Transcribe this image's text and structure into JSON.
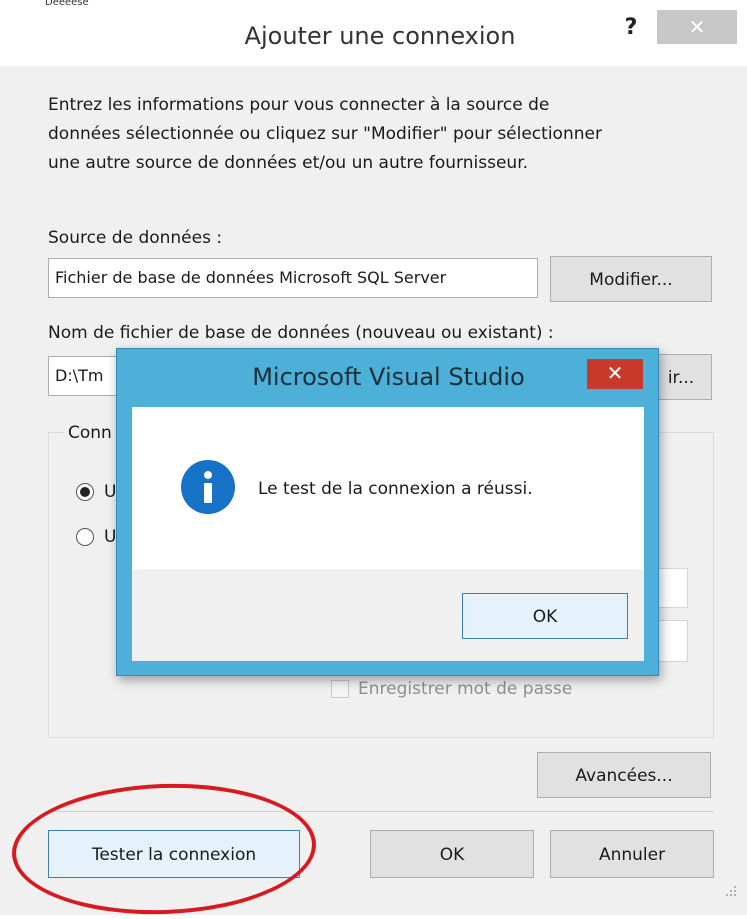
{
  "dialog": {
    "top_strip": "Deeeese",
    "title": "Ajouter une connexion",
    "help": "?",
    "close": "✕",
    "intro_lines": [
      "Entrez les informations pour vous connecter à la source de",
      "données sélectionnée ou cliquez sur \"Modifier\" pour sélectionner",
      "une autre source de données et/ou un autre fournisseur."
    ],
    "source_label": "Source de données :",
    "source_value": "Fichier de base de données Microsoft SQL Server",
    "modify_button": "Modifier...",
    "filename_label": "Nom de fichier de base de données (nouveau ou existant) :",
    "filename_value": "D:\\Tm",
    "browse_button": "ir...",
    "conn_group_label": "Conn",
    "radio1_label": "U",
    "radio2_label": "U",
    "save_password_label": "Enregistrer mot de passe",
    "advanced_button": "Avancées...",
    "test_button": "Tester la connexion",
    "ok_button": "OK",
    "cancel_button": "Annuler"
  },
  "message_box": {
    "title": "Microsoft Visual Studio",
    "close": "✕",
    "icon": "info-icon",
    "message": "Le test de la connexion a réussi.",
    "ok_button": "OK"
  },
  "colors": {
    "annotation_red": "#d71920",
    "msgbox_frame": "#4cb0d8",
    "info_blue": "#1572c7",
    "close_red": "#c93a2c"
  }
}
